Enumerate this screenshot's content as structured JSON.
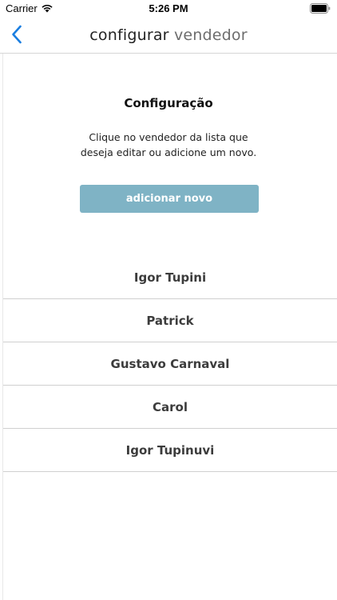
{
  "status_bar": {
    "carrier": "Carrier",
    "time": "5:26 PM",
    "icons": [
      "wifi-icon",
      "battery-icon"
    ]
  },
  "nav": {
    "back_icon": "chevron-left-icon",
    "title_part1": "configurar",
    "title_part2": "vendedor",
    "accent_color": "#1a7ee0"
  },
  "config": {
    "title": "Configuração",
    "instructions_line1": "Clique no vendedor da lista que",
    "instructions_line2": "deseja editar ou adicione um novo.",
    "add_button_label": "adicionar novo",
    "add_button_color": "#7fb3c5"
  },
  "sellers": [
    {
      "name": "Igor Tupini"
    },
    {
      "name": "Patrick"
    },
    {
      "name": "Gustavo Carnaval"
    },
    {
      "name": "Carol"
    },
    {
      "name": "Igor Tupinuvi"
    }
  ]
}
